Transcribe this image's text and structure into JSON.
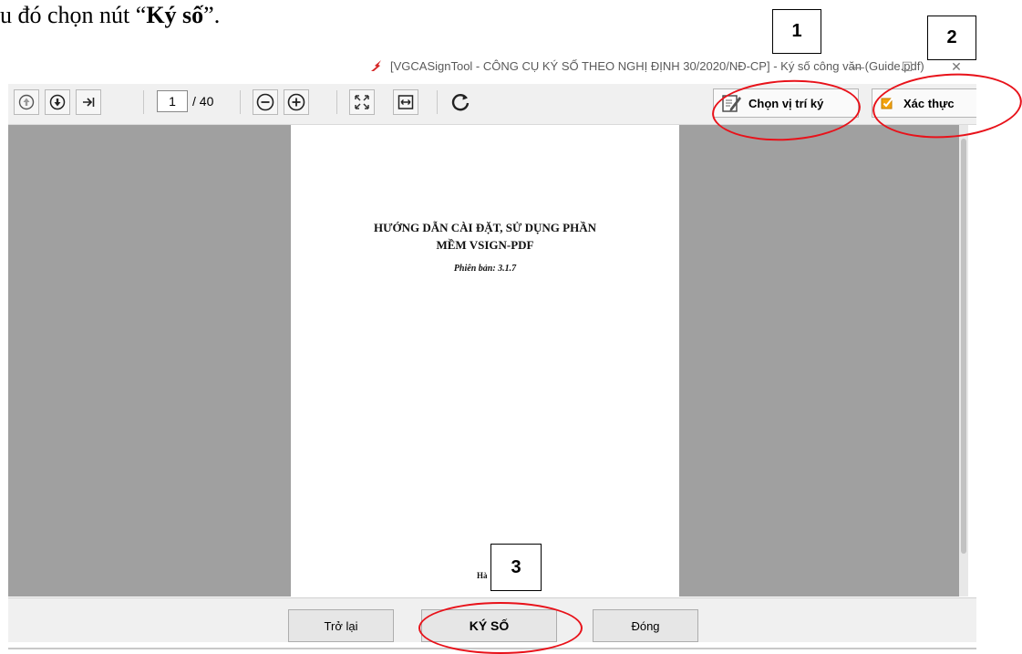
{
  "document_text": {
    "prefix": "u đó chọn nút “",
    "emphasis": "Ký số",
    "suffix": "”."
  },
  "callouts": [
    "1",
    "2",
    "3"
  ],
  "window": {
    "title": "[VGCASignTool - CÔNG CỤ KÝ SỐ THEO NGHỊ ĐỊNH 30/2020/NĐ-CP] - Ký số công văn (Guide.pdf)",
    "minimize_glyph": "—",
    "maximize_glyph": "☐",
    "close_glyph": "✕"
  },
  "toolbar": {
    "current_page": "1",
    "page_total": "/ 40",
    "choose_position_label": "Chọn vị trí ký",
    "verify_label": "Xác thực"
  },
  "document": {
    "title_line1": "HƯỚNG DẪN CÀI ĐẶT, SỬ DỤNG PHẦN",
    "title_line2": "MỀM VSIGN-PDF",
    "version": "Phiên bản: 3.1.7",
    "footer": "Hà"
  },
  "footer": {
    "back_label": "Trở lại",
    "sign_label": "KÝ SỐ",
    "close_label": "Đóng"
  },
  "colors": {
    "highlight_ring": "#e8121a",
    "viewer_background": "#a0a0a0",
    "app_icon": "#d62828"
  },
  "icons": [
    "page-up-icon",
    "page-down-icon",
    "last-page-icon",
    "zoom-out-icon",
    "zoom-in-icon",
    "fit-page-icon",
    "fit-width-icon",
    "rotate-icon",
    "sign-position-icon",
    "verify-icon"
  ]
}
